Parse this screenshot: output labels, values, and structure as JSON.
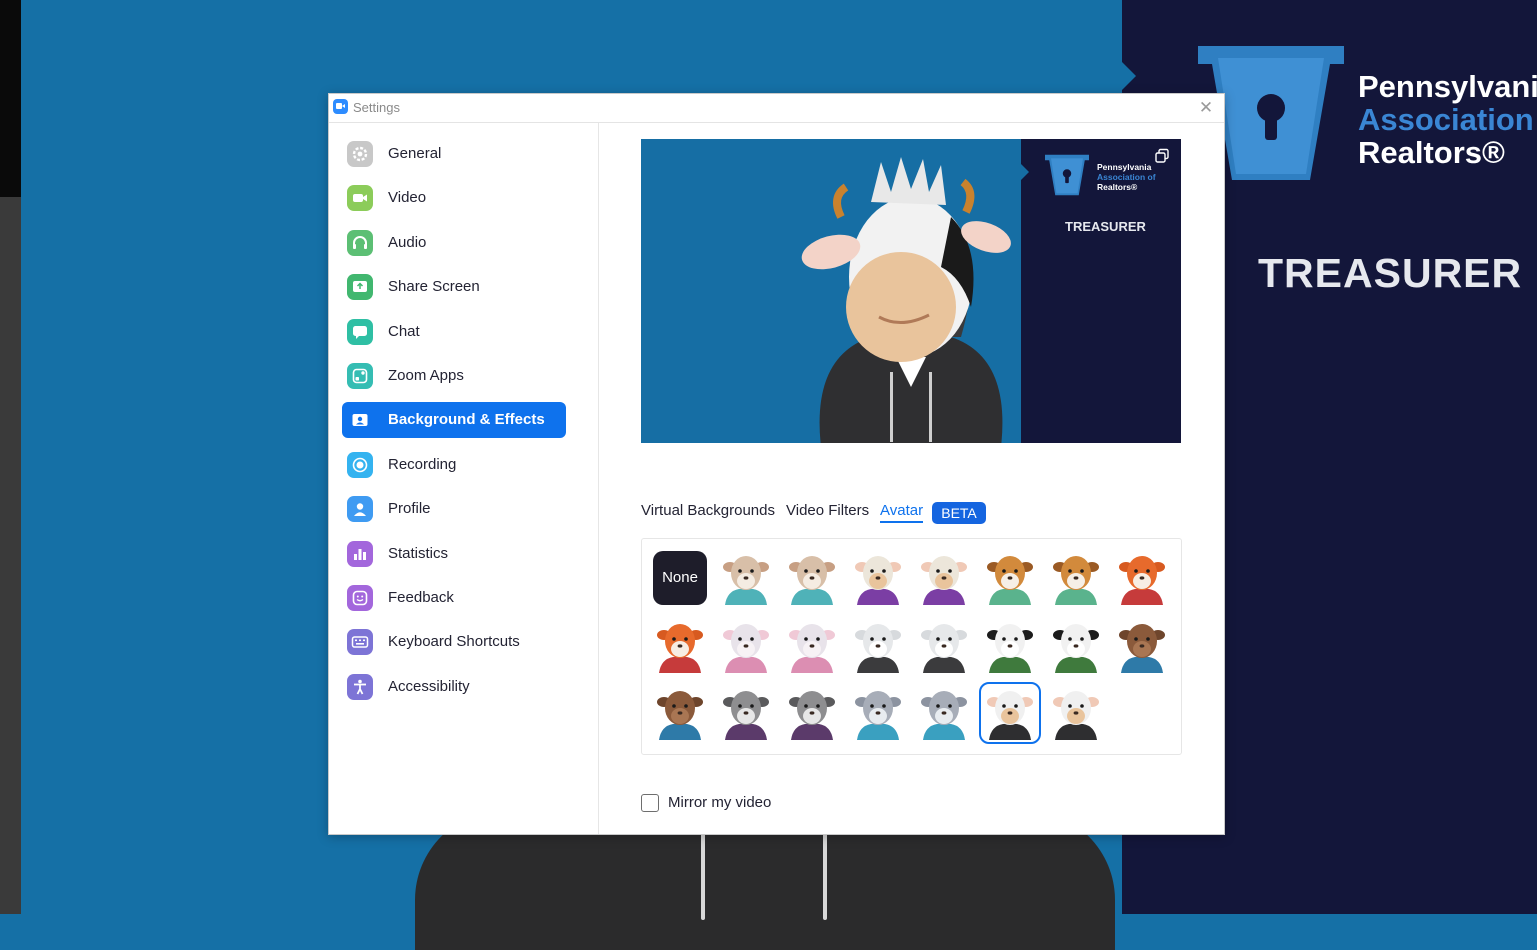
{
  "window": {
    "title": "Settings"
  },
  "background": {
    "org_line1": "Pennsylvani",
    "org_line2": "Association",
    "org_line3": "Realtors®",
    "role": "TREASURER"
  },
  "sidebar": {
    "items": [
      {
        "label": "General",
        "icon": "gear-icon",
        "color": "#c8c8c8"
      },
      {
        "label": "Video",
        "icon": "video-camera-icon",
        "color": "#8ccc5a"
      },
      {
        "label": "Audio",
        "icon": "headphones-icon",
        "color": "#5cbf74"
      },
      {
        "label": "Share Screen",
        "icon": "share-screen-icon",
        "color": "#41b76f"
      },
      {
        "label": "Chat",
        "icon": "chat-bubble-icon",
        "color": "#2fbfa4"
      },
      {
        "label": "Zoom Apps",
        "icon": "zoom-apps-icon",
        "color": "#35bdb3"
      },
      {
        "label": "Background & Effects",
        "icon": "background-effects-icon",
        "color": "#ffffff"
      },
      {
        "label": "Recording",
        "icon": "recording-icon",
        "color": "#34b3f0"
      },
      {
        "label": "Profile",
        "icon": "profile-icon",
        "color": "#3f9bf2"
      },
      {
        "label": "Statistics",
        "icon": "statistics-icon",
        "color": "#a367dc"
      },
      {
        "label": "Feedback",
        "icon": "feedback-smiley-icon",
        "color": "#a367dc"
      },
      {
        "label": "Keyboard Shortcuts",
        "icon": "keyboard-icon",
        "color": "#7d74d6"
      },
      {
        "label": "Accessibility",
        "icon": "accessibility-icon",
        "color": "#7d74d6"
      }
    ],
    "active_index": 6
  },
  "preview": {
    "org_line1": "Pennsylvania",
    "org_line2": "Association of",
    "org_line3": "Realtors®",
    "role": "TREASURER"
  },
  "tabs": {
    "virtual_backgrounds": "Virtual Backgrounds",
    "video_filters": "Video Filters",
    "avatar": "Avatar",
    "beta": "BETA"
  },
  "avatars": {
    "none_label": "None",
    "rows": [
      [
        "none",
        "cat-teal",
        "cat-blue",
        "cow-purple",
        "cow-purple-2",
        "dog-teal",
        "dog-green",
        "fox-red"
      ],
      [
        "fox-red-2",
        "rabbit-pink",
        "rabbit-pink-2",
        "polar-bear-dark",
        "polar-bear-dark-2",
        "panda-green",
        "panda-green-2",
        "beaver-blue"
      ],
      [
        "beaver-blue-2",
        "raccoon-purple",
        "raccoon-purple-2",
        "wolf-teal",
        "wolf-blue",
        "cow-black",
        "cow-black-2"
      ]
    ],
    "selected": "cow-black"
  },
  "mirror": {
    "label": "Mirror my video",
    "checked": false
  }
}
